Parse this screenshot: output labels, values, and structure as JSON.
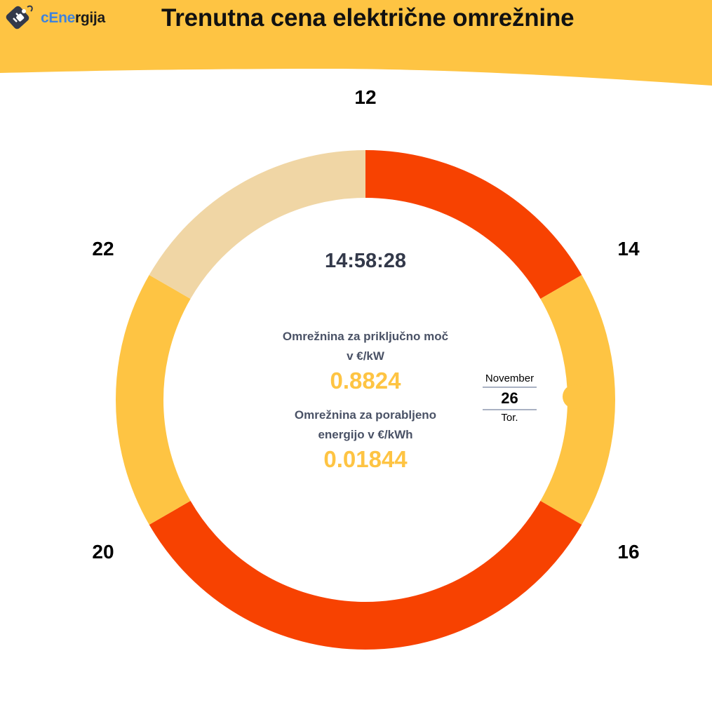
{
  "app": {
    "name_part1": "cEne",
    "name_part2": "rgija",
    "title": "Trenutna cena električne omrežnine"
  },
  "colors": {
    "header": "#fec443",
    "tariff_high": "#f74201",
    "tariff_mid": "#fec443",
    "tariff_low": "#f0d6a5",
    "value_text": "#fec443",
    "clock_text": "#33394a"
  },
  "dial": {
    "hour_labels": [
      "12",
      "14",
      "16",
      "20",
      "22"
    ],
    "segments": [
      {
        "from_hour": 12,
        "to_hour": 14,
        "tariff": "high"
      },
      {
        "from_hour": 14,
        "to_hour": 16,
        "tariff": "mid"
      },
      {
        "from_hour": 16,
        "to_hour": 20,
        "tariff": "high"
      },
      {
        "from_hour": 20,
        "to_hour": 22,
        "tariff": "mid"
      },
      {
        "from_hour": 22,
        "to_hour": 24,
        "tariff": "low"
      }
    ],
    "current_time_hour": 14.97
  },
  "clock": {
    "time": "14:58:28"
  },
  "power": {
    "label_line1": "Omrežnina za priključno moč",
    "label_line2": "v €/kW",
    "value": "0.8824"
  },
  "energy": {
    "label_line1": "Omrežnina za porabljeno",
    "label_line2": "energijo v €/kWh",
    "value": "0.01844"
  },
  "date": {
    "month": "November",
    "day": "26",
    "weekday": "Tor."
  }
}
